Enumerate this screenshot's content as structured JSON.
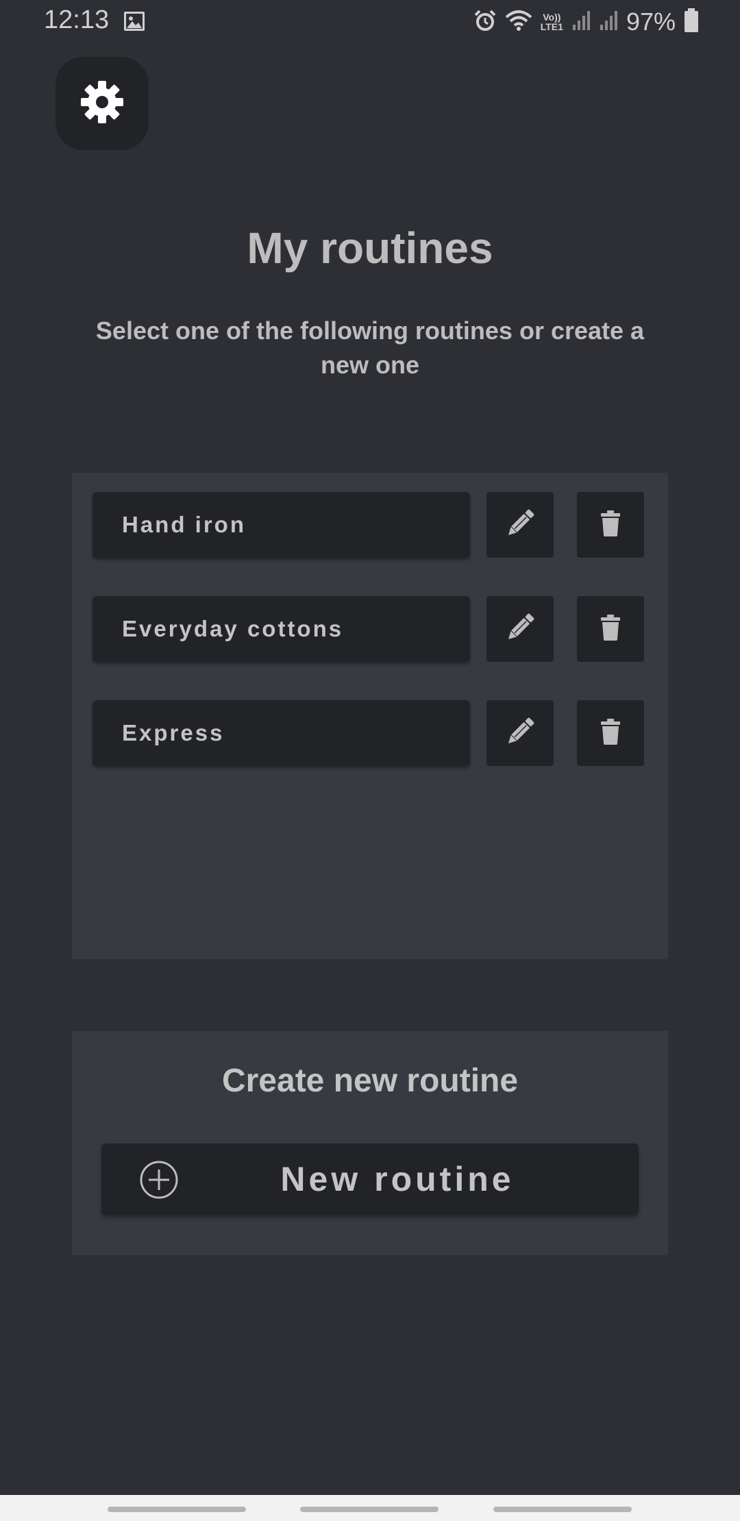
{
  "status_bar": {
    "time": "12:13",
    "lte_top": "Vo))",
    "lte_bottom": "LTE1",
    "battery": "97%"
  },
  "header": {
    "title": "My routines",
    "subtitle": "Select one of the following routines or create a new one"
  },
  "routines": [
    {
      "name": "Hand iron"
    },
    {
      "name": "Everyday cottons"
    },
    {
      "name": "Express"
    }
  ],
  "create": {
    "title": "Create new routine",
    "button_label": "New routine"
  },
  "colors": {
    "background": "#2e2f34",
    "panel": "#383a42",
    "button": "#222327",
    "text": "#c4c4c4"
  },
  "icons": {
    "settings": "gear-icon",
    "edit": "pencil-icon",
    "delete": "trash-icon",
    "add": "plus-circle-icon"
  }
}
